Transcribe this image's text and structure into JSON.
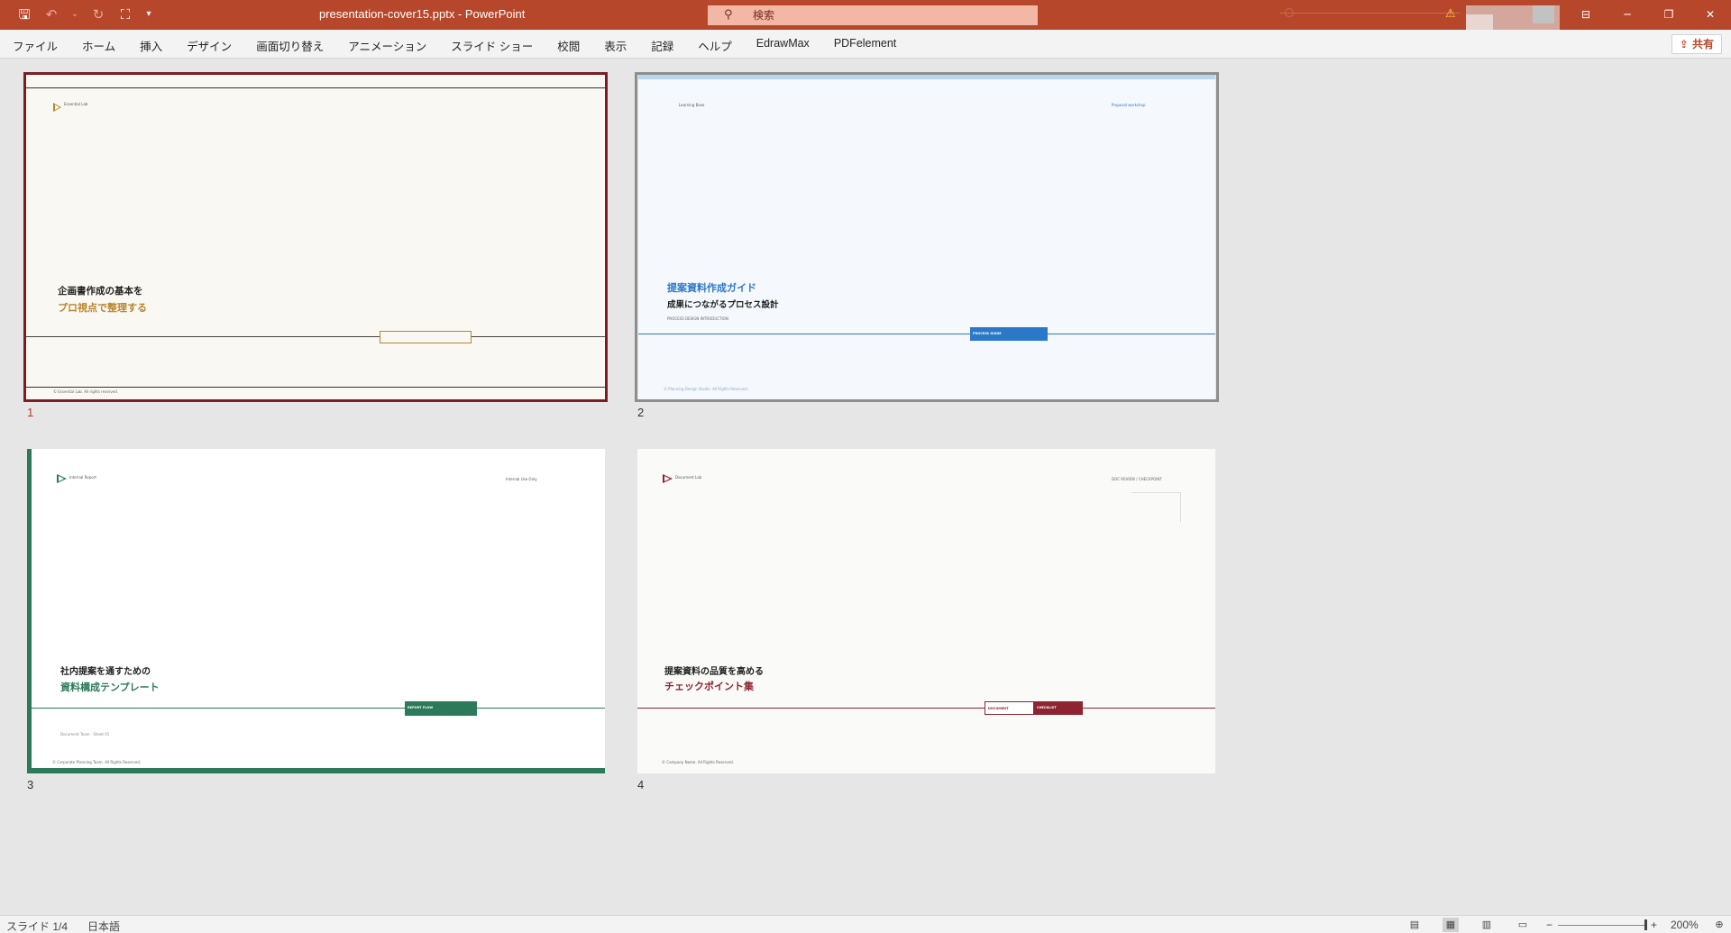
{
  "titlebar": {
    "title": "presentation-cover15.pptx  -  PowerPoint",
    "search_placeholder": "検索",
    "qat_icons": [
      "save-icon",
      "undo-icon",
      "redo-icon",
      "presenter-icon",
      "customize-icon"
    ],
    "window_buttons": [
      "ribbon-display-icon",
      "minimize-icon",
      "restore-icon",
      "close-icon"
    ]
  },
  "ribbon": {
    "tabs": [
      "ファイル",
      "ホーム",
      "挿入",
      "デザイン",
      "画面切り替え",
      "アニメーション",
      "スライド ショー",
      "校閲",
      "表示",
      "記録",
      "ヘルプ",
      "EdrawMax",
      "PDFelement"
    ],
    "share_label": "共有"
  },
  "slides": [
    {
      "number": "1",
      "logo_text": "Essential Lab",
      "title_line1": "企画書作成の基本を",
      "title_line2": "プロ視点で整理する",
      "footer": "© Essential Lab. All rights reserved.",
      "accent": "#b8862d",
      "selected": true
    },
    {
      "number": "2",
      "brand_text": "Learning Base",
      "top_right": "Proposal workshop",
      "title_line1": "提案資料作成ガイド",
      "title_line2": "成果につながるプロセス設計",
      "sub": "PROCESS DESIGN INTRODUCTION",
      "badge": "PROCESS GUIDE",
      "footer": "© Planning Design Studio. All Rights Reserved.",
      "accent": "#2b78c9"
    },
    {
      "number": "3",
      "logo_text": "Internal Report",
      "top_right": "Internal Use Only",
      "title_line1": "社内提案を通すための",
      "title_line2": "資料構成テンプレート",
      "badge": "REPORT FLOW",
      "sub": "Document Team · Sheet 01",
      "footer": "© Corporate Planning Team. All Rights Reserved.",
      "accent": "#2c7a5a"
    },
    {
      "number": "4",
      "logo_text": "Document Lab",
      "top_right": "DOC REVIEW  /  CHECKPOINT",
      "title_line1": "提案資料の品質を高める",
      "title_line2": "チェックポイント集",
      "badge_left": "DOCUMENT",
      "badge_right": "CHECKLIST",
      "footer": "© Company Name. All Rights Reserved.",
      "accent": "#8e2430"
    }
  ],
  "statusbar": {
    "slide_indicator": "スライド 1/4",
    "language": "日本語",
    "zoom": "200%",
    "zoom_minus": "−",
    "zoom_plus": "+"
  }
}
